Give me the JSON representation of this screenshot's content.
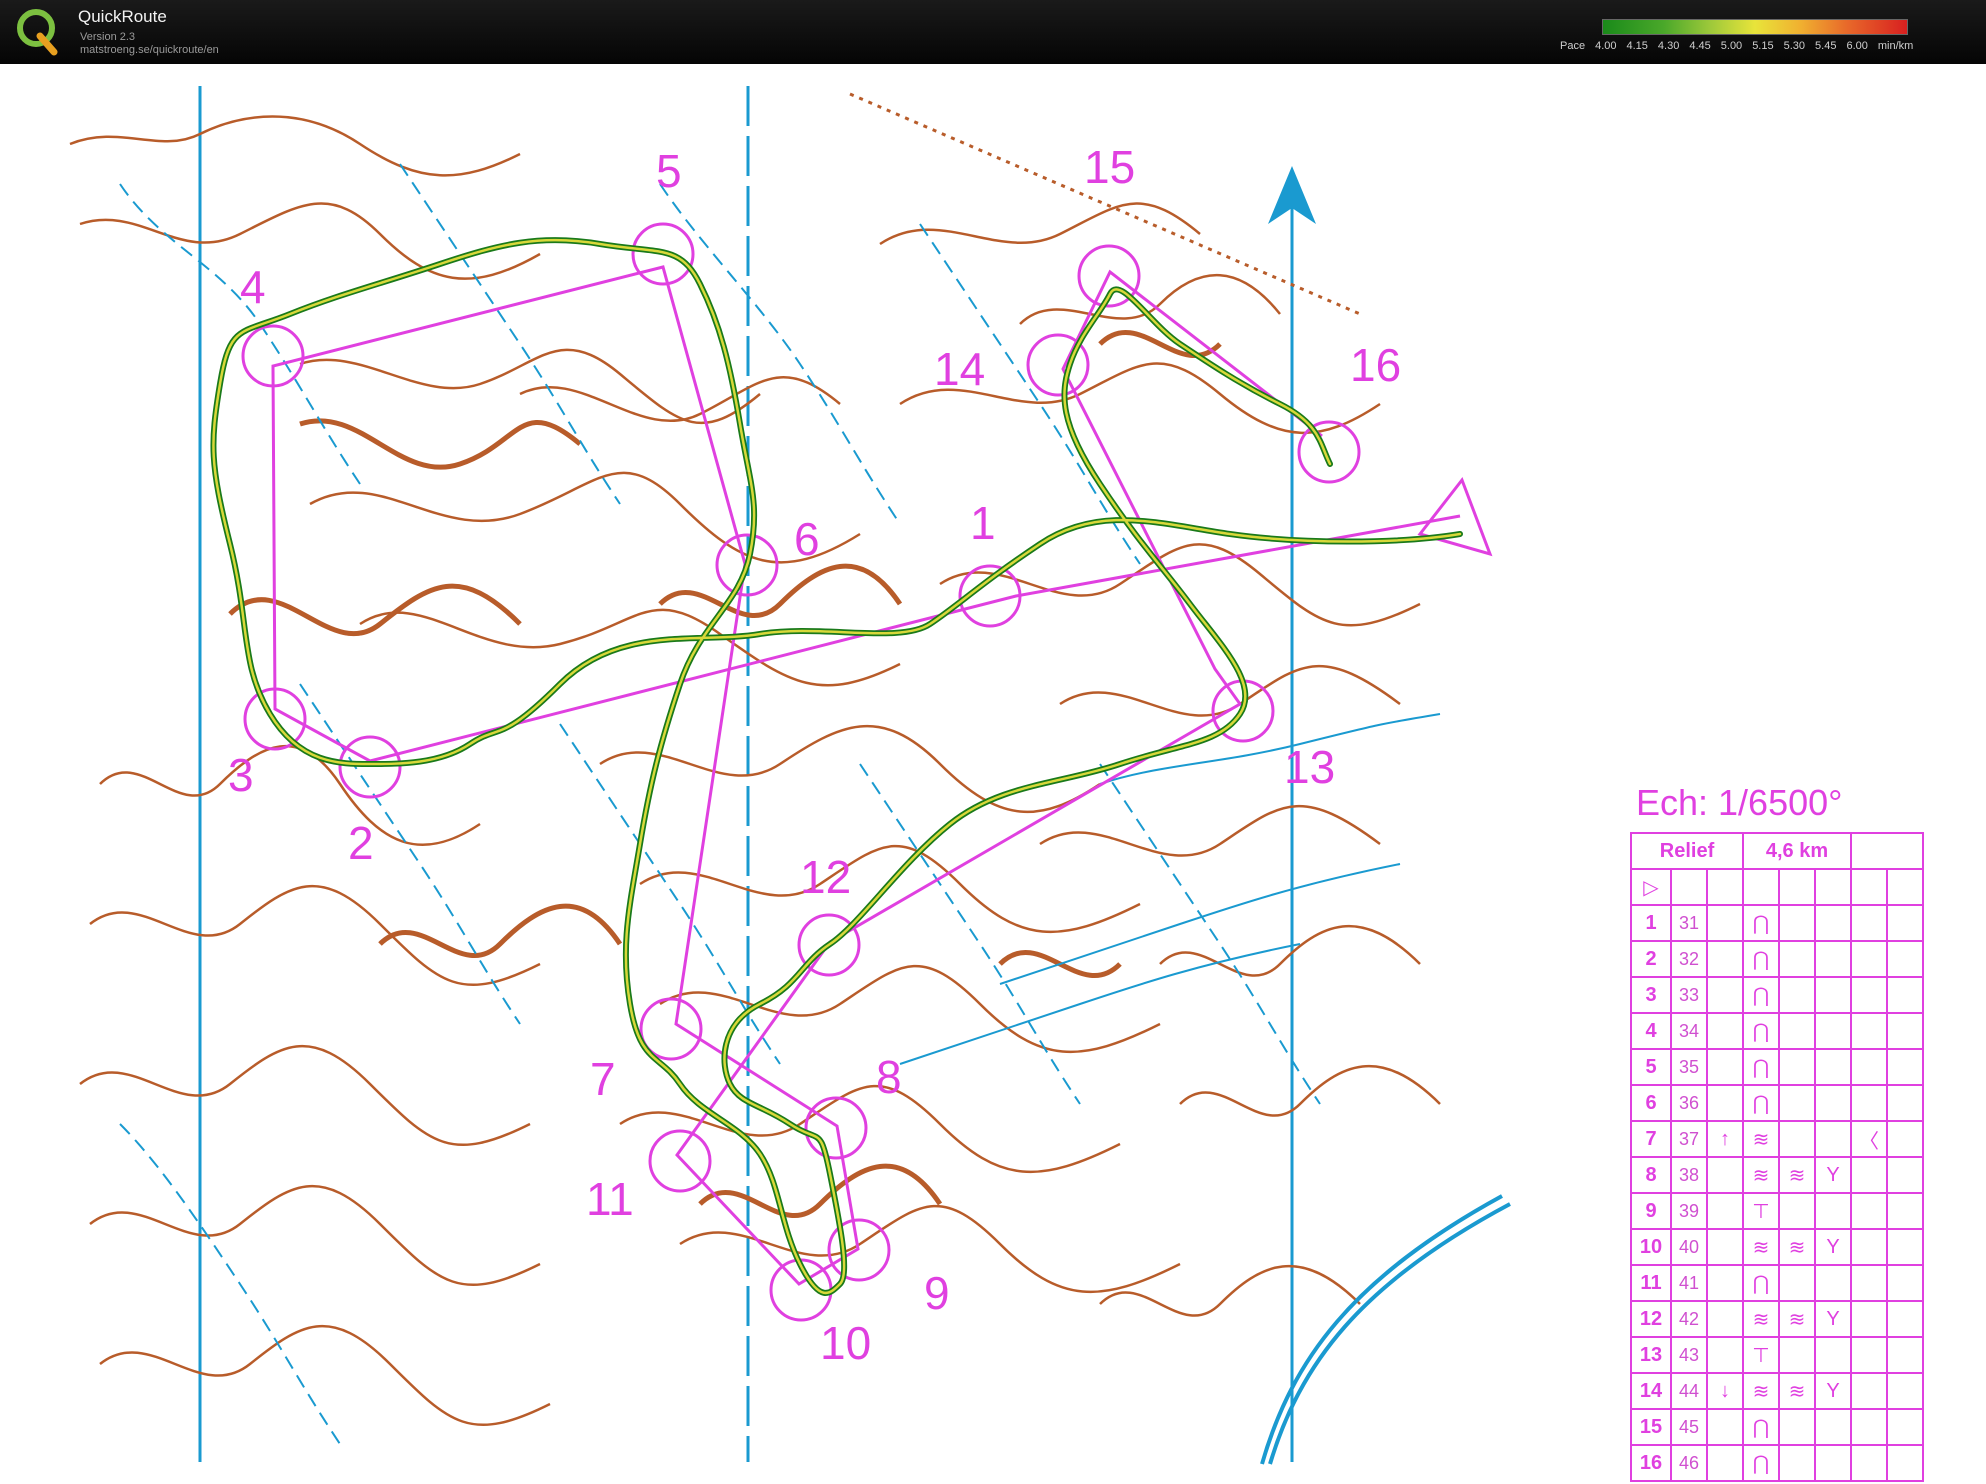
{
  "app": {
    "title": "QuickRoute",
    "version": "Version 2.3",
    "url": "matstroeng.se/quickroute/en",
    "logo_icon": "quickroute-q-logo-icon"
  },
  "pace_legend": {
    "label": "Pace",
    "ticks": [
      "4.00",
      "4.15",
      "4.30",
      "4.45",
      "5.00",
      "5.15",
      "5.30",
      "5.45",
      "6.00"
    ],
    "unit": "min/km",
    "colors": [
      "#1a8a1a",
      "#9cc83a",
      "#e8e43a",
      "#e86a2a",
      "#d82020"
    ]
  },
  "map": {
    "scale": "Ech: 1/6500°",
    "course_color": "#e040e0",
    "contour_color": "#b85c2a",
    "water_color": "#1a9ad0",
    "start_icon": "start-triangle-icon",
    "north_icon": "north-arrow-icon",
    "controls": [
      "1",
      "2",
      "3",
      "4",
      "5",
      "6",
      "7",
      "8",
      "9",
      "10",
      "11",
      "12",
      "13",
      "14",
      "15",
      "16"
    ]
  },
  "description_sheet": {
    "header_left": "Relief",
    "header_right": "4,6 km",
    "rows": [
      {
        "num": "1",
        "code": "31",
        "sym1": "",
        "sym2": "⋂",
        "sym3": "",
        "sym4": "",
        "sym5": ""
      },
      {
        "num": "2",
        "code": "32",
        "sym1": "",
        "sym2": "⋂",
        "sym3": "",
        "sym4": "",
        "sym5": ""
      },
      {
        "num": "3",
        "code": "33",
        "sym1": "",
        "sym2": "⋂",
        "sym3": "",
        "sym4": "",
        "sym5": ""
      },
      {
        "num": "4",
        "code": "34",
        "sym1": "",
        "sym2": "⋂",
        "sym3": "",
        "sym4": "",
        "sym5": ""
      },
      {
        "num": "5",
        "code": "35",
        "sym1": "",
        "sym2": "⋂",
        "sym3": "",
        "sym4": "",
        "sym5": ""
      },
      {
        "num": "6",
        "code": "36",
        "sym1": "",
        "sym2": "⋂",
        "sym3": "",
        "sym4": "",
        "sym5": ""
      },
      {
        "num": "7",
        "code": "37",
        "sym1": "↑",
        "sym2": "≋",
        "sym3": "",
        "sym4": "",
        "sym5": "〈"
      },
      {
        "num": "8",
        "code": "38",
        "sym1": "",
        "sym2": "≋",
        "sym3": "≋",
        "sym4": "Y",
        "sym5": ""
      },
      {
        "num": "9",
        "code": "39",
        "sym1": "",
        "sym2": "⊤",
        "sym3": "",
        "sym4": "",
        "sym5": ""
      },
      {
        "num": "10",
        "code": "40",
        "sym1": "",
        "sym2": "≋",
        "sym3": "≋",
        "sym4": "Y",
        "sym5": ""
      },
      {
        "num": "11",
        "code": "41",
        "sym1": "",
        "sym2": "⋂",
        "sym3": "",
        "sym4": "",
        "sym5": ""
      },
      {
        "num": "12",
        "code": "42",
        "sym1": "",
        "sym2": "≋",
        "sym3": "≋",
        "sym4": "Y",
        "sym5": ""
      },
      {
        "num": "13",
        "code": "43",
        "sym1": "",
        "sym2": "⊤",
        "sym3": "",
        "sym4": "",
        "sym5": ""
      },
      {
        "num": "14",
        "code": "44",
        "sym1": "↓",
        "sym2": "≋",
        "sym3": "≋",
        "sym4": "Y",
        "sym5": ""
      },
      {
        "num": "15",
        "code": "45",
        "sym1": "",
        "sym2": "⋂",
        "sym3": "",
        "sym4": "",
        "sym5": ""
      },
      {
        "num": "16",
        "code": "46",
        "sym1": "",
        "sym2": "⋂",
        "sym3": "",
        "sym4": "",
        "sym5": ""
      }
    ]
  }
}
